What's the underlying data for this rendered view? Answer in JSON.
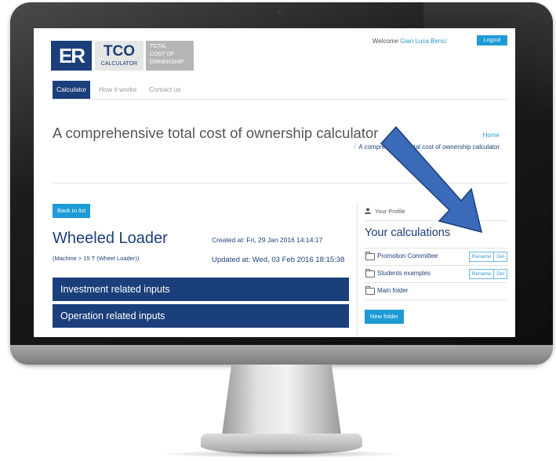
{
  "header": {
    "logo_mark": "ER",
    "logo_tco": "TCO",
    "logo_calculator": "CALCULATOR",
    "logo_total": "TOTAL",
    "logo_cost_of": "COST OF",
    "logo_ownership": "OWNERSHIP",
    "welcome_label": "Welcome",
    "user_name": "Gian Luca Benci",
    "logout_label": "Logout"
  },
  "nav": {
    "items": [
      {
        "label": "Calculator",
        "active": true
      },
      {
        "label": "How it works",
        "active": false
      },
      {
        "label": "Contact us",
        "active": false
      }
    ]
  },
  "page": {
    "title": "A comprehensive total cost of ownership calculator",
    "breadcrumb_home": "Home",
    "breadcrumb_separator": "/",
    "breadcrumb_current": "A comprehensive total cost of ownership calculator"
  },
  "main": {
    "back_label": "Back to list",
    "machine_title": "Wheeled Loader",
    "machine_category": "(Machine > 15 T (Wheel Loader))",
    "created": "Created at: Fri, 29 Jan 2016 14:14:17",
    "updated": "Updated at: Wed, 03 Feb 2016 18:15:38",
    "sections": [
      {
        "label": "Investment related inputs"
      },
      {
        "label": "Operation related inputs"
      }
    ]
  },
  "sidebar": {
    "profile_label": "Your Profile",
    "heading": "Your calculations",
    "folders": [
      {
        "name": "Promotion Committee",
        "rename": "Rename",
        "del": "Del"
      },
      {
        "name": "Students examples",
        "rename": "Rename",
        "del": "Del"
      },
      {
        "name": "Main folder"
      }
    ],
    "new_folder_label": "New folder"
  },
  "colors": {
    "brand_navy": "#1b3f7a",
    "accent_blue": "#1e9ad6",
    "arrow_blue": "#3a6ab8"
  }
}
